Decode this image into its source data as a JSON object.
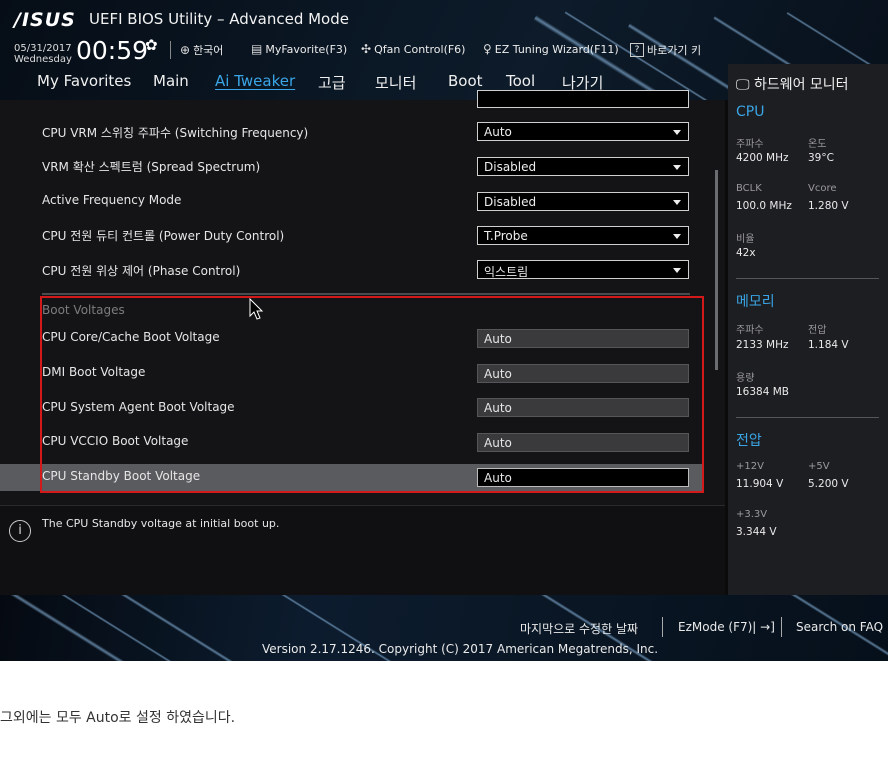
{
  "header": {
    "logo": "/ISUS",
    "title": "UEFI BIOS Utility – Advanced Mode",
    "date": "05/31/2017",
    "weekday": "Wednesday",
    "time": "00:59",
    "language": "한국어",
    "myfavorite": "MyFavorite(F3)",
    "qfan": "Qfan Control(F6)",
    "ez_tuning": "EZ Tuning Wizard(F11)",
    "hotkeys": "바로가기 키"
  },
  "tabs": [
    "My Favorites",
    "Main",
    "Ai Tweaker",
    "고급",
    "모니터",
    "Boot",
    "Tool",
    "나가기"
  ],
  "active_tab": "Ai Tweaker",
  "settings": [
    {
      "label": "CPU VRM 스위칭 주파수 (Switching Frequency)",
      "value": "Auto"
    },
    {
      "label": "VRM 확산 스펙트럼 (Spread Spectrum)",
      "value": "Disabled"
    },
    {
      "label": "Active Frequency Mode",
      "value": "Disabled"
    },
    {
      "label": "CPU 전원 듀티 컨트롤 (Power Duty Control)",
      "value": "T.Probe"
    },
    {
      "label": "CPU 전원 위상 제어 (Phase Control)",
      "value": "익스트림"
    }
  ],
  "boot_voltages": {
    "group_label": "Boot Voltages",
    "items": [
      {
        "label": "CPU Core/Cache Boot Voltage",
        "value": "Auto"
      },
      {
        "label": "DMI Boot Voltage",
        "value": "Auto"
      },
      {
        "label": "CPU System Agent Boot Voltage",
        "value": "Auto"
      },
      {
        "label": "CPU VCCIO Boot Voltage",
        "value": "Auto"
      },
      {
        "label": "CPU Standby Boot Voltage",
        "value": "Auto"
      }
    ]
  },
  "help_text": "The CPU Standby voltage at initial boot up.",
  "monitor": {
    "title": "하드웨어 모니터",
    "cpu": {
      "heading": "CPU",
      "freq_k": "주파수",
      "freq_v": "4200 MHz",
      "temp_k": "온도",
      "temp_v": "39°C",
      "bclk_k": "BCLK",
      "bclk_v": "100.0 MHz",
      "vcore_k": "Vcore",
      "vcore_v": "1.280 V",
      "ratio_k": "비율",
      "ratio_v": "42x"
    },
    "memory": {
      "heading": "메모리",
      "freq_k": "주파수",
      "freq_v": "2133 MHz",
      "volt_k": "전압",
      "volt_v": "1.184 V",
      "cap_k": "용량",
      "cap_v": "16384 MB"
    },
    "voltage": {
      "heading": "전압",
      "v12_k": "+12V",
      "v12_v": "11.904 V",
      "v5_k": "+5V",
      "v5_v": "5.200 V",
      "v33_k": "+3.3V",
      "v33_v": "3.344 V"
    }
  },
  "footer": {
    "last_modified": "마지막으로 수정한 날짜",
    "ezmode": "EzMode (F7)|",
    "faq": "Search on FAQ",
    "version": "Version 2.17.1246. Copyright (C) 2017 American Megatrends, Inc."
  },
  "caption": "그외에는 모두 Auto로 설정 하였습니다.",
  "colors": {
    "accent": "#3aa5e6",
    "highlight_border": "#d31919",
    "selected_row": "#5a5b5e"
  }
}
